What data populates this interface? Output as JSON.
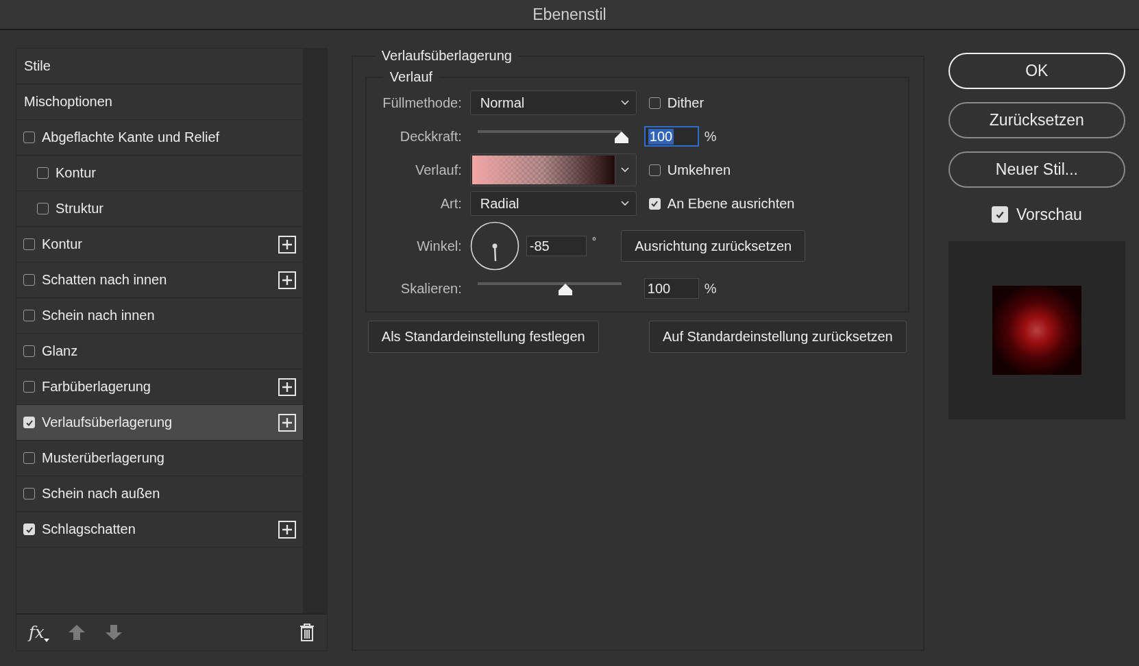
{
  "window": {
    "title": "Ebenenstil"
  },
  "styles": [
    {
      "label": "Stile",
      "kind": "header",
      "selected": false
    },
    {
      "label": "Mischoptionen",
      "kind": "header",
      "selected": false
    },
    {
      "label": "Abgeflachte Kante und Relief",
      "kind": "effect",
      "checked": false,
      "selected": false,
      "addable": false,
      "children": [
        {
          "label": "Kontur",
          "kind": "effect",
          "checked": false,
          "selected": false,
          "addable": false
        },
        {
          "label": "Struktur",
          "kind": "effect",
          "checked": false,
          "selected": false,
          "addable": false
        }
      ]
    },
    {
      "label": "Kontur",
      "kind": "effect",
      "checked": false,
      "selected": false,
      "addable": true
    },
    {
      "label": "Schatten nach innen",
      "kind": "effect",
      "checked": false,
      "selected": false,
      "addable": true
    },
    {
      "label": "Schein nach innen",
      "kind": "effect",
      "checked": false,
      "selected": false,
      "addable": false
    },
    {
      "label": "Glanz",
      "kind": "effect",
      "checked": false,
      "selected": false,
      "addable": false
    },
    {
      "label": "Farbüberlagerung",
      "kind": "effect",
      "checked": false,
      "selected": false,
      "addable": true
    },
    {
      "label": "Verlaufsüberlagerung",
      "kind": "effect",
      "checked": true,
      "selected": true,
      "addable": true
    },
    {
      "label": "Musterüberlagerung",
      "kind": "effect",
      "checked": false,
      "selected": false,
      "addable": false
    },
    {
      "label": "Schein nach außen",
      "kind": "effect",
      "checked": false,
      "selected": false,
      "addable": false
    },
    {
      "label": "Schlagschatten",
      "kind": "effect",
      "checked": true,
      "selected": false,
      "addable": true
    }
  ],
  "footer": {
    "fx_label": "fx"
  },
  "section": {
    "title": "Verlaufsüberlagerung",
    "group": "Verlauf",
    "blend_mode": {
      "label": "Füllmethode:",
      "value": "Normal"
    },
    "dither": {
      "label": "Dither",
      "checked": false
    },
    "opacity": {
      "label": "Deckkraft:",
      "level": 1,
      "value": "100",
      "focused": true,
      "unit": "%"
    },
    "gradient": {
      "label": "Verlauf:"
    },
    "reverse": {
      "label": "Umkehren",
      "checked": false
    },
    "style": {
      "label": "Art:",
      "value": "Radial"
    },
    "align": {
      "label": "An Ebene ausrichten",
      "checked": true
    },
    "angle": {
      "label": "Winkel:",
      "value": "-85",
      "unit": "°"
    },
    "reset_alignment": "Ausrichtung zurücksetzen",
    "scale": {
      "label": "Skalieren:",
      "level": 0.61,
      "value": "100",
      "focused": false,
      "unit": "%"
    },
    "buttons": [
      "Als Standardeinstellung festlegen",
      "Auf Standardeinstellung zurücksetzen"
    ]
  },
  "actions": [
    {
      "label": "OK",
      "default": true
    },
    {
      "label": "Zurücksetzen",
      "default": false
    },
    {
      "label": "Neuer Stil...",
      "default": false
    }
  ],
  "preview": {
    "label": "Vorschau",
    "checked": true
  }
}
